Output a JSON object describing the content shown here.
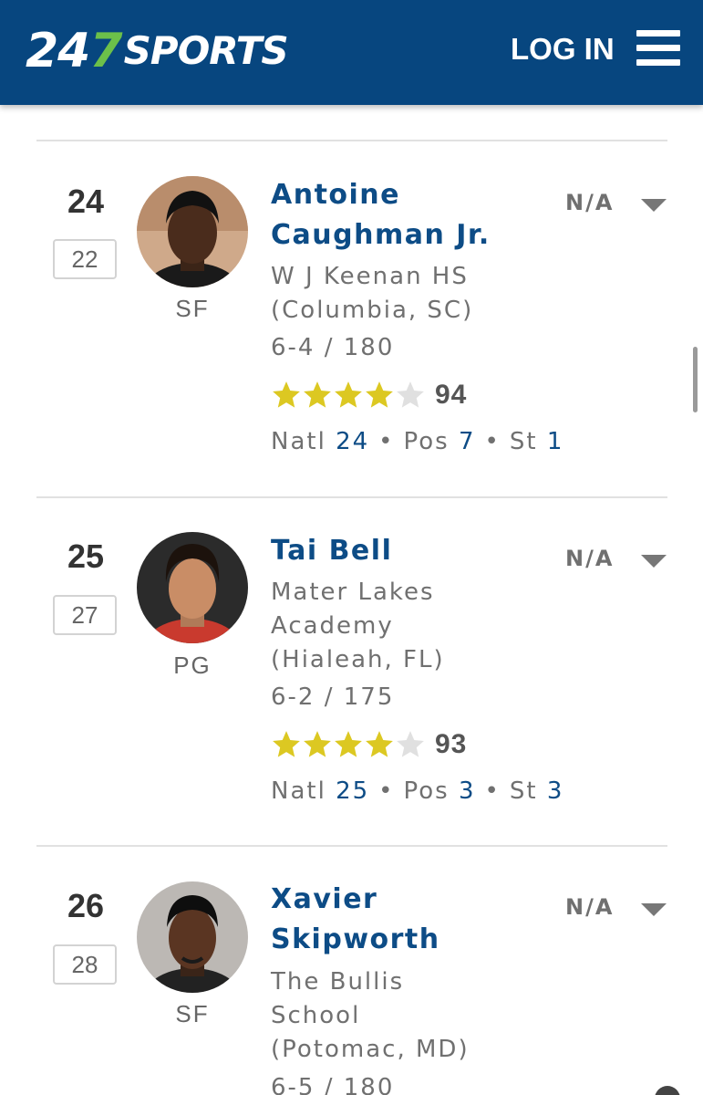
{
  "header": {
    "logo_num_a": "24",
    "logo_num_b": "7",
    "logo_word": "SPORTS",
    "login_label": "LOG IN",
    "menu_icon": "hamburger-menu-icon",
    "brand_color": "#07467f",
    "logo_accent_color": "#6cc04a"
  },
  "players": [
    {
      "rank": "24",
      "previous_rank": "22",
      "position": "SF",
      "name_line1": "Antoine",
      "name_line2": "Caughman Jr.",
      "school_line1": "W J Keenan HS",
      "school_line2": "(Columbia, SC)",
      "school_line3": "",
      "height_weight": "6-4 / 180",
      "stars": 4,
      "rating": "94",
      "natl_label": "Natl",
      "natl": "24",
      "pos_label": "Pos",
      "pos": "7",
      "st_label": "St",
      "st": "1",
      "status": "N/A"
    },
    {
      "rank": "25",
      "previous_rank": "27",
      "position": "PG",
      "name_line1": "Tai Bell",
      "name_line2": "",
      "school_line1": "Mater Lakes",
      "school_line2": "Academy",
      "school_line3": "(Hialeah, FL)",
      "height_weight": "6-2 / 175",
      "stars": 4,
      "rating": "93",
      "natl_label": "Natl",
      "natl": "25",
      "pos_label": "Pos",
      "pos": "3",
      "st_label": "St",
      "st": "3",
      "status": "N/A"
    },
    {
      "rank": "26",
      "previous_rank": "28",
      "position": "SF",
      "name_line1": "Xavier",
      "name_line2": "Skipworth",
      "school_line1": "The Bullis",
      "school_line2": "School",
      "school_line3": "(Potomac, MD)",
      "height_weight": "6-5 / 180",
      "status": "N/A"
    }
  ],
  "colors": {
    "link_blue": "#0d4c86",
    "star_gold": "#dcc822",
    "star_empty": "#e0e0e0",
    "text_gray": "#707070"
  }
}
